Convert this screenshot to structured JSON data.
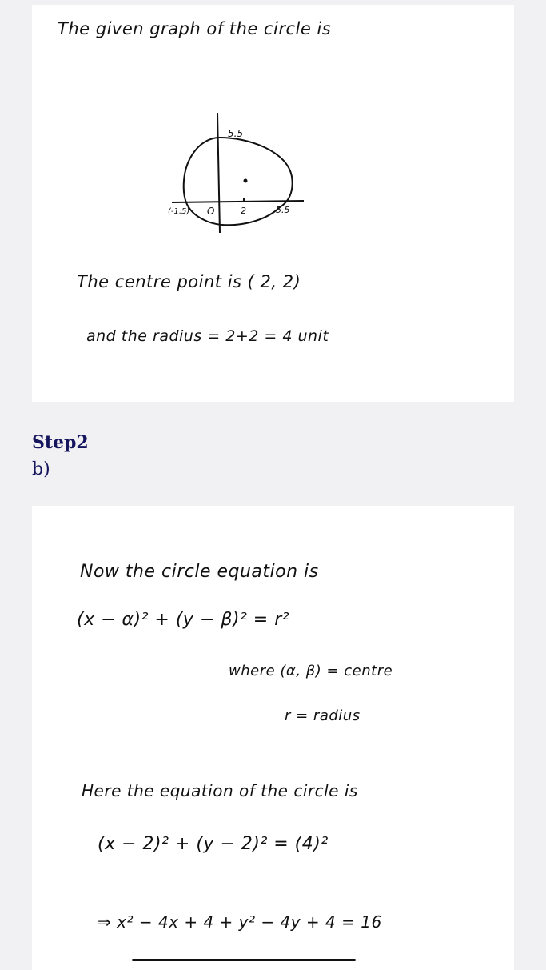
{
  "card1": {
    "line1": "The   given graph of the circle is",
    "diagram": {
      "label_top": "5.5",
      "label_right": "5.5",
      "label_x_tick": "2",
      "label_origin": "O",
      "label_left": "(-1.5)"
    },
    "line2": "The   centre   point   is ( 2, 2)",
    "line3": "and    the    radius  =    2+2 = 4  unit"
  },
  "step": {
    "heading": "Step2",
    "sub": "b)"
  },
  "card2": {
    "line1": "Now   the  circle  equation  is",
    "line2": "(x − α)² + (y − β)² = r²",
    "line3": "where  (α, β) =  centre",
    "line4": "r =  radius",
    "line5": "Here   the   equation  of  the  circle is",
    "line6": "(x − 2)² + (y − 2)² = (4)²",
    "line7": "⇒ x² − 4x + 4 + y² − 4y + 4 = 16"
  }
}
